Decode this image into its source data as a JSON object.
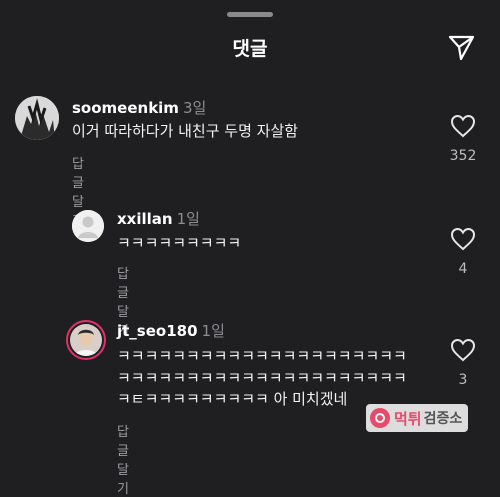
{
  "header": {
    "title": "댓글",
    "send_icon": "send-icon"
  },
  "comments": [
    {
      "username": "soomeenkim",
      "time": "3일",
      "text": "이거 따라하다가 내친구 두명 자살함",
      "reply_label": "답글 달기",
      "likes": "352"
    },
    {
      "username": "xxillan",
      "time": "1일",
      "text": "ㅋㅋㅋㅋㅋㅋㅋㅋㅋ",
      "reply_label": "답글 달기",
      "likes": "4"
    },
    {
      "username": "jt_seo180",
      "time": "1일",
      "text_lines": [
        "ㅋㅋㅋㅋㅋㅋㅋㅋㅋㅋㅋㅋㅋㅋㅋㅋㅋㅋㅋㅋㅋ",
        "ㅋㅋㅋㅋㅋㅋㅋㅋㅋㅋㅋㅋㅋㅋㅋㅋㅋㅋㅋㅋㅋ",
        "ㅋㅌㅋㅋㅋㅋㅋㅋㅋㅋㅋ 아 미치겠네"
      ],
      "reply_label": "답글 달기",
      "likes": "3"
    }
  ],
  "watermark": {
    "text1": "먹튀",
    "text2": "검증소"
  },
  "colors": {
    "background": "#1f1f21",
    "accent_ring": "#e1306c",
    "watermark": "#e84a6a"
  }
}
